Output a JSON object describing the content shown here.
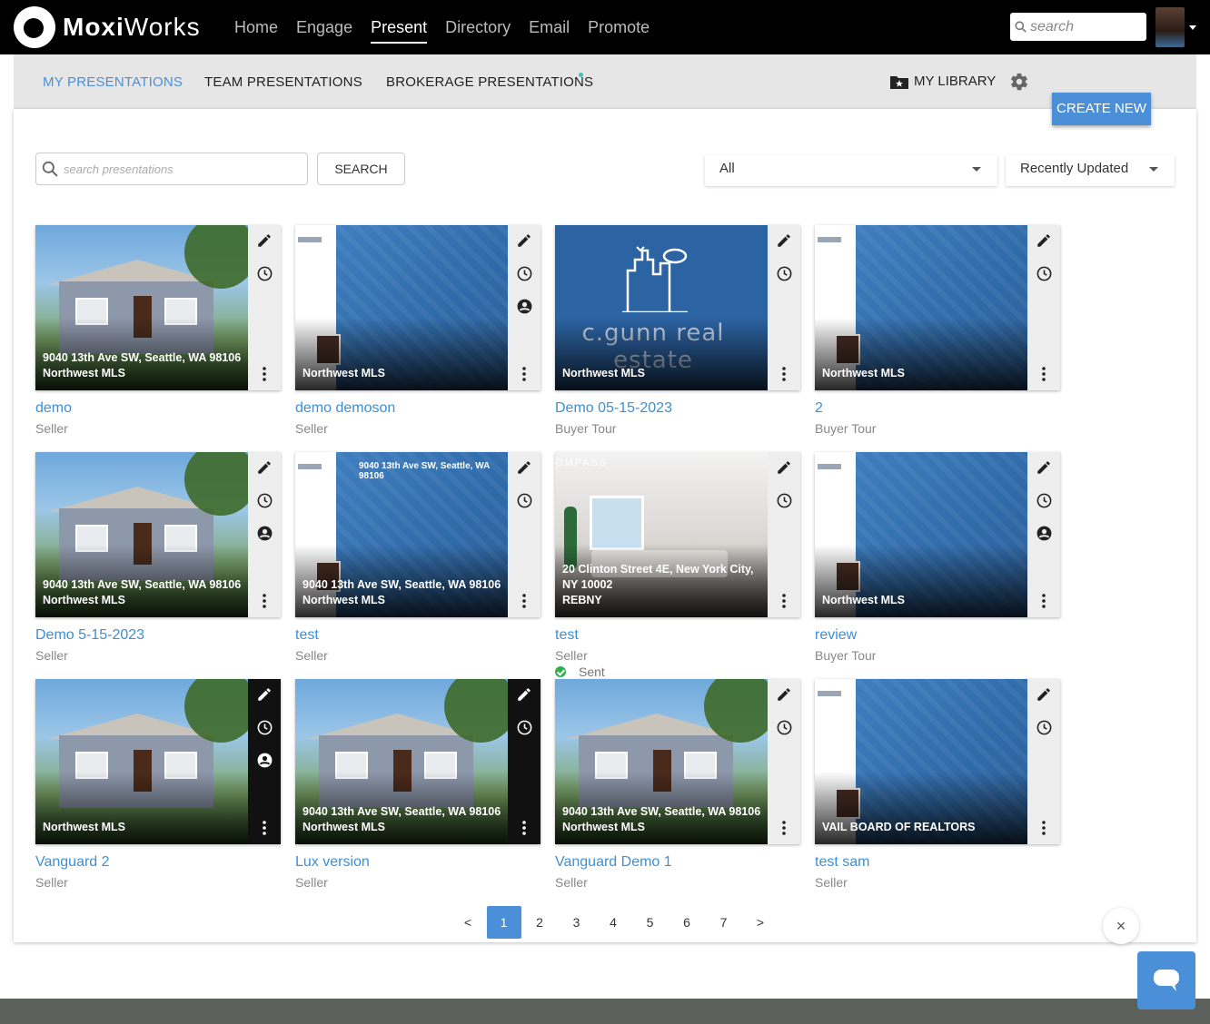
{
  "brand": {
    "name_bold": "Moxi",
    "name_rest": "Works"
  },
  "nav": {
    "links": [
      "Home",
      "Engage",
      "Present",
      "Directory",
      "Email",
      "Promote"
    ],
    "active": "Present",
    "search_placeholder": "search"
  },
  "subnav": {
    "tabs": [
      "MY PRESENTATIONS",
      "TEAM PRESENTATIONS",
      "BROKERAGE PRESENTATIONS"
    ],
    "active": "MY PRESENTATIONS",
    "library_label": "MY LIBRARY",
    "create_label": "CREATE NEW"
  },
  "filters": {
    "search_placeholder": "search presentations",
    "search_button": "SEARCH",
    "type_filter": "All",
    "sort": "Recently Updated"
  },
  "cards": [
    {
      "title": "demo",
      "type": "Seller",
      "image": "house",
      "address": "9040 13th Ave SW, Seattle, WA 98106",
      "mls": "Northwest MLS",
      "icons": [
        "pencil-icon",
        "clock-icon"
      ],
      "dark": false
    },
    {
      "title": "demo demoson",
      "type": "Seller",
      "image": "agent",
      "address": "",
      "mls": "Northwest MLS",
      "icons": [
        "pencil-icon",
        "clock-icon",
        "person-icon"
      ],
      "dark": false
    },
    {
      "title": "Demo 05-15-2023",
      "type": "Buyer Tour",
      "image": "gunn",
      "address": "",
      "mls": "Northwest MLS",
      "logo_line1": "c.gunn real",
      "logo_line2": "estate",
      "icons": [
        "pencil-icon",
        "clock-icon"
      ],
      "dark": false
    },
    {
      "title": "2",
      "type": "Buyer Tour",
      "image": "agent",
      "address": "",
      "mls": "Northwest MLS",
      "icons": [
        "pencil-icon",
        "clock-icon"
      ],
      "dark": false
    },
    {
      "title": "Demo 5-15-2023",
      "type": "Seller",
      "image": "house",
      "address": "9040 13th Ave SW, Seattle, WA 98106",
      "mls": "Northwest MLS",
      "icons": [
        "pencil-icon",
        "clock-icon",
        "person-icon"
      ],
      "dark": false
    },
    {
      "title": "test",
      "type": "Seller",
      "image": "agent",
      "top_text": "9040 13th Ave SW, Seattle, WA 98106",
      "address": "9040 13th Ave SW, Seattle, WA 98106",
      "mls": "Northwest MLS",
      "icons": [
        "pencil-icon",
        "clock-icon"
      ],
      "dark": false
    },
    {
      "title": "test",
      "type": "Seller",
      "image": "room",
      "brand_mark": "OMPASS",
      "address": "20 Clinton Street 4E, New York City, NY 10002",
      "mls": "REBNY",
      "icons": [
        "pencil-icon",
        "clock-icon"
      ],
      "dark": false,
      "sent": "Sent"
    },
    {
      "title": "review",
      "type": "Buyer Tour",
      "image": "agent",
      "address": "",
      "mls": "Northwest MLS",
      "icons": [
        "pencil-icon",
        "clock-icon",
        "person-icon"
      ],
      "dark": false
    },
    {
      "title": "Vanguard 2",
      "type": "Seller",
      "image": "house",
      "address": "",
      "mls": "Northwest MLS",
      "icons": [
        "pencil-icon",
        "clock-icon",
        "person-icon"
      ],
      "dark": true
    },
    {
      "title": "Lux version",
      "type": "Seller",
      "image": "house",
      "address": "9040 13th Ave SW, Seattle, WA 98106",
      "mls": "Northwest MLS",
      "icons": [
        "pencil-icon",
        "clock-icon"
      ],
      "dark": true
    },
    {
      "title": "Vanguard Demo 1",
      "type": "Seller",
      "image": "house",
      "address": "9040 13th Ave SW, Seattle, WA 98106",
      "mls": "Northwest MLS",
      "icons": [
        "pencil-icon",
        "clock-icon"
      ],
      "dark": false
    },
    {
      "title": "test sam",
      "type": "Seller",
      "image": "agent",
      "address": "",
      "mls": "VAIL BOARD OF REALTORS",
      "icons": [
        "pencil-icon",
        "clock-icon"
      ],
      "dark": false
    }
  ],
  "pagination": {
    "prev": "<",
    "pages": [
      "1",
      "2",
      "3",
      "4",
      "5",
      "6",
      "7"
    ],
    "current": "1",
    "next": ">"
  },
  "chat": {
    "close": "×"
  },
  "colors": {
    "accent": "#4a8fd8",
    "link": "#3d8fd6",
    "sent": "#2bb24c",
    "nav_bg": "#000000"
  }
}
